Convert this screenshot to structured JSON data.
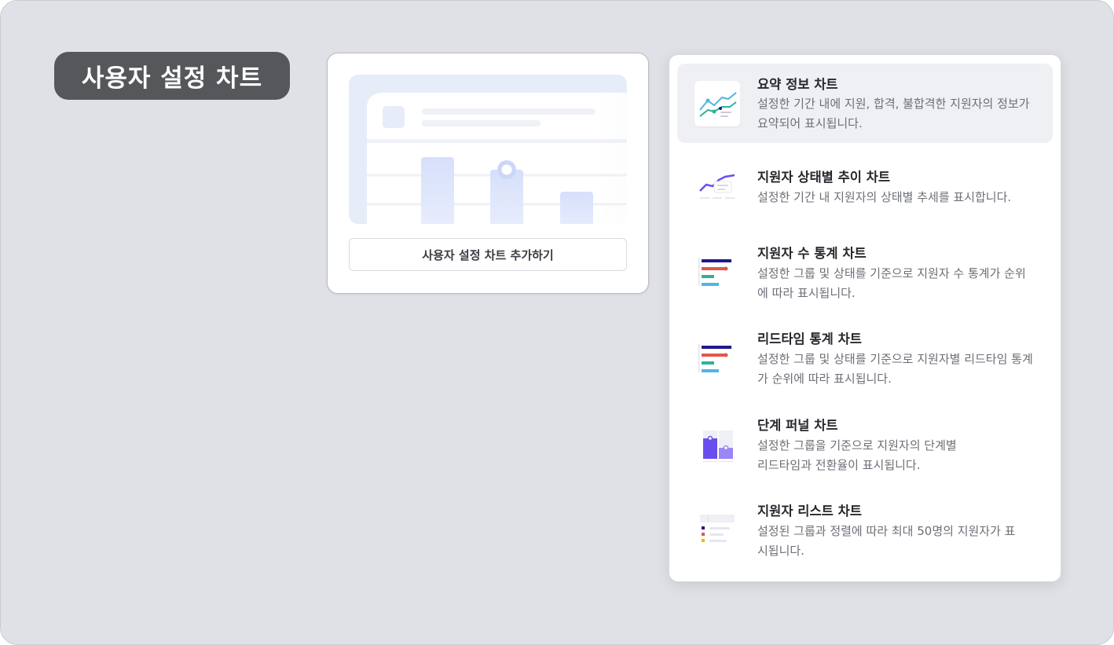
{
  "page_title": "사용자 설정 차트",
  "preview": {
    "add_button_label": "사용자 설정 차트 추가하기"
  },
  "menu": {
    "items": [
      {
        "title": "요약 정보 차트",
        "description": "설정한 기간 내에 지원, 합격, 불합격한 지원자의 정보가 요약되어 표시됩니다.",
        "icon": "summary-line-chart-icon",
        "active": true
      },
      {
        "title": "지원자 상태별 추이 차트",
        "description": "설정한 기간 내 지원자의 상태별 추세를 표시합니다.",
        "icon": "trend-line-chart-icon",
        "active": false
      },
      {
        "title": "지원자 수 통계 차트",
        "description": "설정한 그룹 및 상태를 기준으로 지원자 수 통계가 순위에 따라 표시됩니다.",
        "icon": "horizontal-bar-chart-icon",
        "active": false
      },
      {
        "title": "리드타임 통계 차트",
        "description": "설정한 그룹 및 상태를 기준으로 지원자별 리드타임 통계가 순위에 따라 표시됩니다.",
        "icon": "horizontal-bar-chart-icon",
        "active": false
      },
      {
        "title": "단계 퍼널 차트",
        "description_lines": [
          "설정한 그룹을 기준으로 지원자의 단계별",
          "리드타임과 전환율이 표시됩니다."
        ],
        "icon": "funnel-chart-icon",
        "active": false
      },
      {
        "title": "지원자 리스트 차트",
        "description": "설정된 그룹과 정렬에 따라 최대 50명의 지원자가 표시됩니다.",
        "icon": "list-table-icon",
        "active": false
      }
    ]
  },
  "colors": {
    "background": "#dfe1e6",
    "badge": "#55575b",
    "active_item": "#eef0f4",
    "navy": "#1f1a8c",
    "coral": "#e2574c",
    "teal": "#2bb39a",
    "sky": "#4fb6e3",
    "purple": "#6b4ef0"
  }
}
